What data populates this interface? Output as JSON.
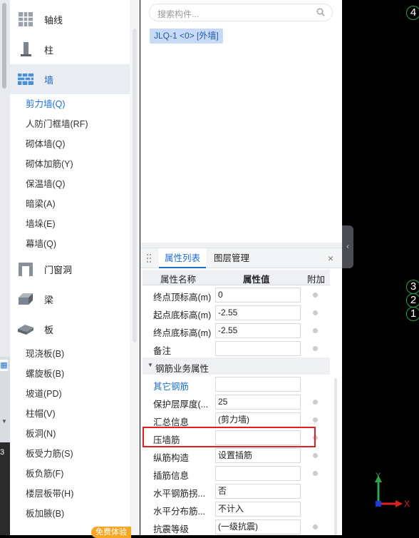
{
  "left_edge": {
    "digit": "3"
  },
  "tree": {
    "categories": [
      {
        "label": "轴线",
        "icon": "grid-icon"
      },
      {
        "label": "柱",
        "icon": "column-icon"
      },
      {
        "label": "墙",
        "icon": "wall-icon"
      },
      {
        "label": "门窗洞",
        "icon": "door-window-icon"
      },
      {
        "label": "梁",
        "icon": "beam-icon"
      },
      {
        "label": "板",
        "icon": "slab-icon"
      }
    ],
    "wall_items": [
      "剪力墙(Q)",
      "人防门框墙(RF)",
      "砌体墙(Q)",
      "砌体加筋(Y)",
      "保温墙(Q)",
      "暗梁(A)",
      "墙垛(E)",
      "幕墙(Q)"
    ],
    "slab_items": [
      "现浇板(B)",
      "螺旋板(B)",
      "坡道(PD)",
      "柱帽(V)",
      "板洞(N)",
      "板受力筋(S)",
      "板负筋(F)",
      "楼层板带(H)",
      "板加腋(B)"
    ],
    "free_badge": "免费体验"
  },
  "search": {
    "placeholder": "搜索构件..."
  },
  "selected_component": "JLQ-1 <0> [外墙]",
  "props": {
    "tabs": [
      "属性列表",
      "图层管理"
    ],
    "columns": [
      "属性名称",
      "属性值",
      "附加"
    ],
    "rows_top": [
      {
        "name": "终点顶标高(m)",
        "value": "0"
      },
      {
        "name": "起点底标高(m)",
        "value": "-2.55"
      },
      {
        "name": "终点底标高(m)",
        "value": "-2.55"
      },
      {
        "name": "备注",
        "value": ""
      }
    ],
    "section_label": "钢筋业务属性",
    "rows_rebar": [
      {
        "name": "其它钢筋",
        "value": ""
      },
      {
        "name": "保护层厚度(...",
        "value": "25"
      },
      {
        "name": "汇总信息",
        "value": "(剪力墙)"
      },
      {
        "name": "压墙筋",
        "value": ""
      },
      {
        "name": "纵筋构造",
        "value": "设置插筋"
      },
      {
        "name": "插筋信息",
        "value": ""
      },
      {
        "name": "水平钢筋拐...",
        "value": "否"
      },
      {
        "name": "水平分布筋...",
        "value": "不计入"
      },
      {
        "name": "抗震等级",
        "value": "(一级抗震)"
      }
    ]
  },
  "canvas": {
    "bubbles_top": [
      "4"
    ],
    "bubbles_mid": [
      "3",
      "2",
      "1"
    ],
    "axis_y": "Y",
    "axis_x": "X"
  },
  "colors": {
    "accent": "#1a6fd1",
    "highlight": "#e02020",
    "axis_green": "#2ea44f"
  }
}
